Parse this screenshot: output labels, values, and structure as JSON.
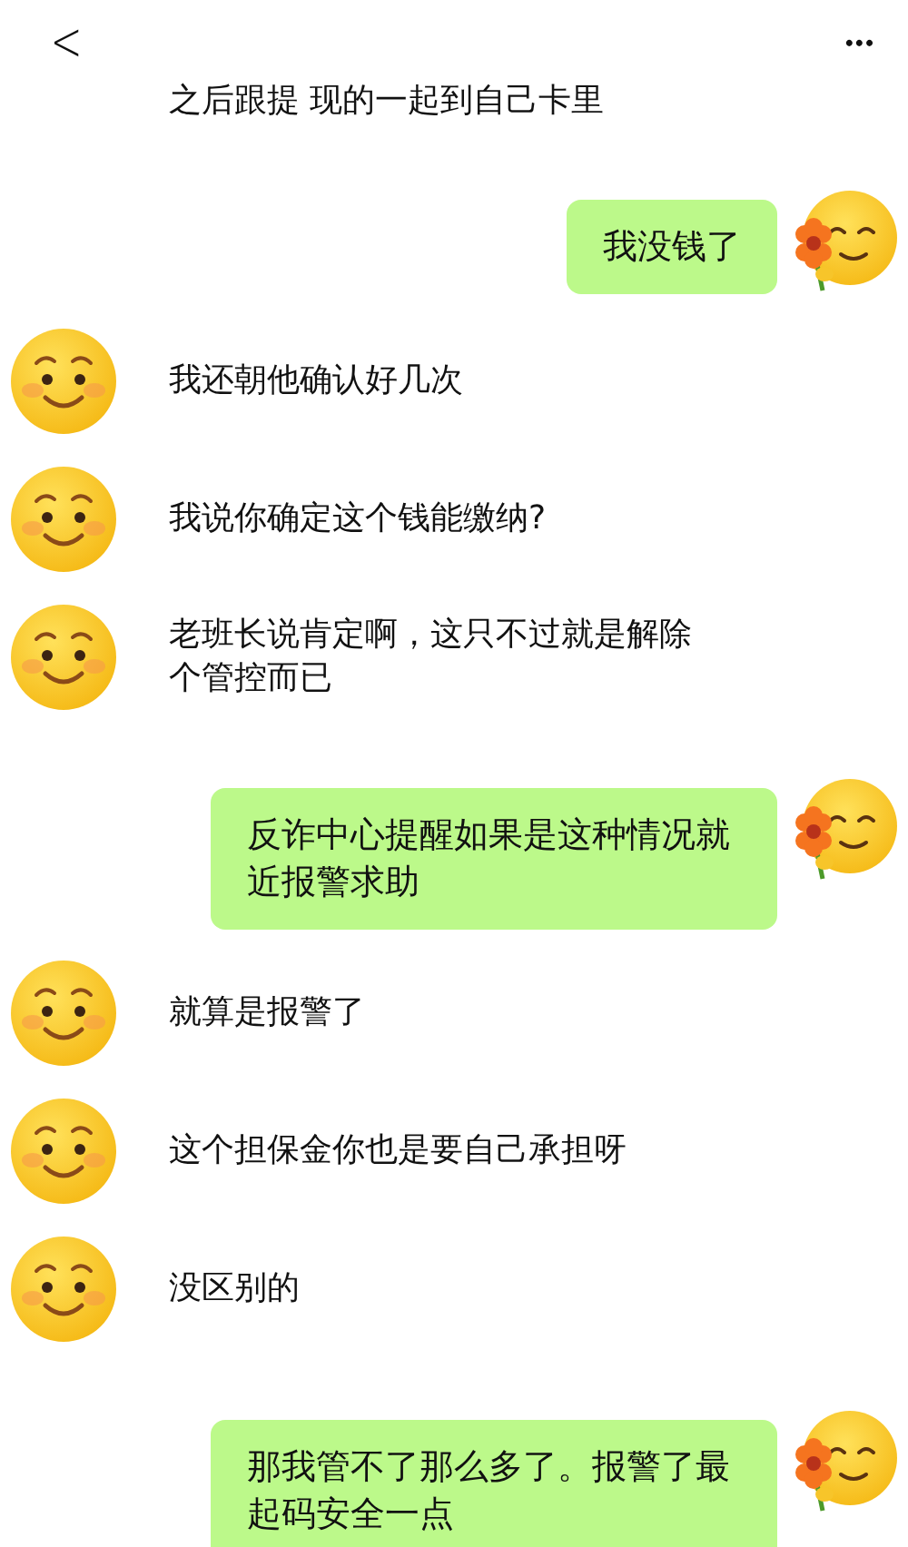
{
  "header": {
    "back": "<",
    "menu": "•••"
  },
  "messages": [
    {
      "kind": "text-only",
      "text": "之后跟提 现的一起到自己卡里"
    },
    {
      "kind": "sent",
      "text": "我没钱了"
    },
    {
      "kind": "received",
      "text": "我还朝他确认好几次"
    },
    {
      "kind": "received",
      "text": "我说你确定这个钱能缴纳?"
    },
    {
      "kind": "received",
      "text": "老班长说肯定啊，这只不过就是解除个管控而已"
    },
    {
      "kind": "sent",
      "text": "反诈中心提醒如果是这种情况就近报警求助"
    },
    {
      "kind": "received",
      "text": "就算是报警了"
    },
    {
      "kind": "received",
      "text": "这个担保金你也是要自己承担呀"
    },
    {
      "kind": "received",
      "text": "没区别的"
    },
    {
      "kind": "sent",
      "text": "那我管不了那么多了。报警了最起码安全一点"
    }
  ]
}
